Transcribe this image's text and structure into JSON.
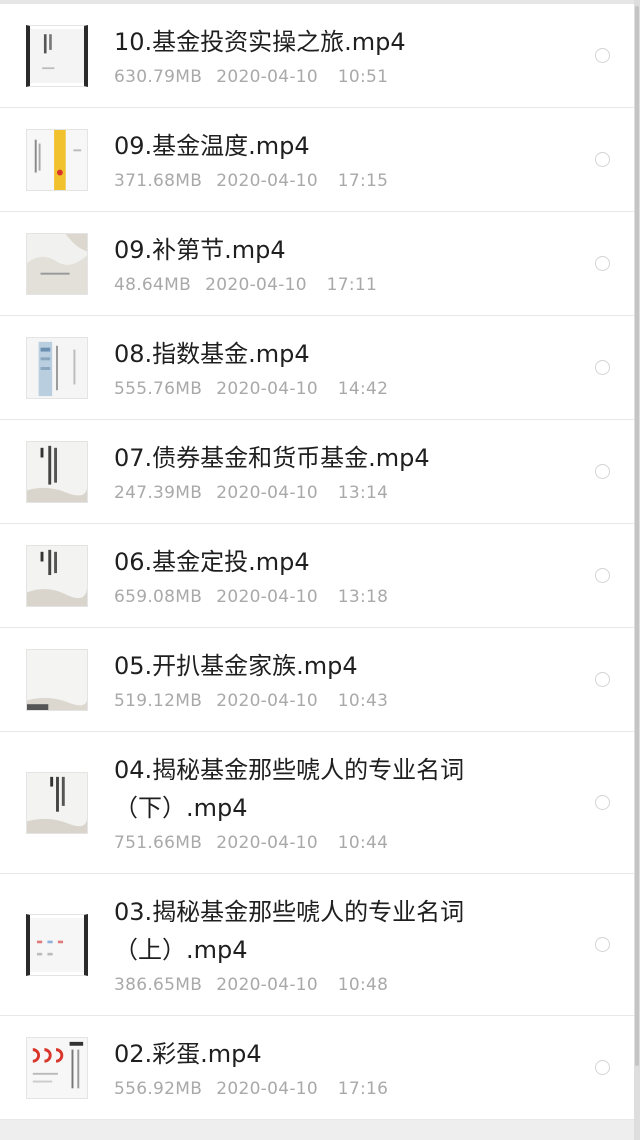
{
  "files": [
    {
      "name": "10.基金投资实操之旅.mp4",
      "size": "630.79MB",
      "date": "2020-04-10",
      "time": "10:51",
      "thumb": "dark-edge-cover-icon"
    },
    {
      "name": "09.基金温度.mp4",
      "size": "371.68MB",
      "date": "2020-04-10",
      "time": "17:15",
      "thumb": "yellow-stripe-cover-icon"
    },
    {
      "name": "09.补第节.mp4",
      "size": "48.64MB",
      "date": "2020-04-10",
      "time": "17:11",
      "thumb": "landscape-cover-icon"
    },
    {
      "name": "08.指数基金.mp4",
      "size": "555.76MB",
      "date": "2020-04-10",
      "time": "14:42",
      "thumb": "blue-stripe-cover-icon"
    },
    {
      "name": "07.债券基金和货币基金.mp4",
      "size": "247.39MB",
      "date": "2020-04-10",
      "time": "13:14",
      "thumb": "title-cover-icon"
    },
    {
      "name": "06.基金定投.mp4",
      "size": "659.08MB",
      "date": "2020-04-10",
      "time": "13:18",
      "thumb": "title-cover-icon"
    },
    {
      "name": "05.开扒基金家族.mp4",
      "size": "519.12MB",
      "date": "2020-04-10",
      "time": "10:43",
      "thumb": "blank-cover-icon"
    },
    {
      "name_line1": "04.揭秘基金那些唬人的专业名词",
      "name_line2": "（下）.mp4",
      "size": "751.66MB",
      "date": "2020-04-10",
      "time": "10:44",
      "thumb": "title-cover-icon"
    },
    {
      "name_line1": "03.揭秘基金那些唬人的专业名词",
      "name_line2": "（上）.mp4",
      "size": "386.65MB",
      "date": "2020-04-10",
      "time": "10:48",
      "thumb": "dark-edge-cover-icon"
    },
    {
      "name": "02.彩蛋.mp4",
      "size": "556.92MB",
      "date": "2020-04-10",
      "time": "17:16",
      "thumb": "chart-cover-icon"
    }
  ],
  "colors": {
    "text": "#1f1f1f",
    "meta": "#a9a9a9",
    "accent_yellow": "#f2c12e",
    "accent_red": "#d9362b"
  }
}
